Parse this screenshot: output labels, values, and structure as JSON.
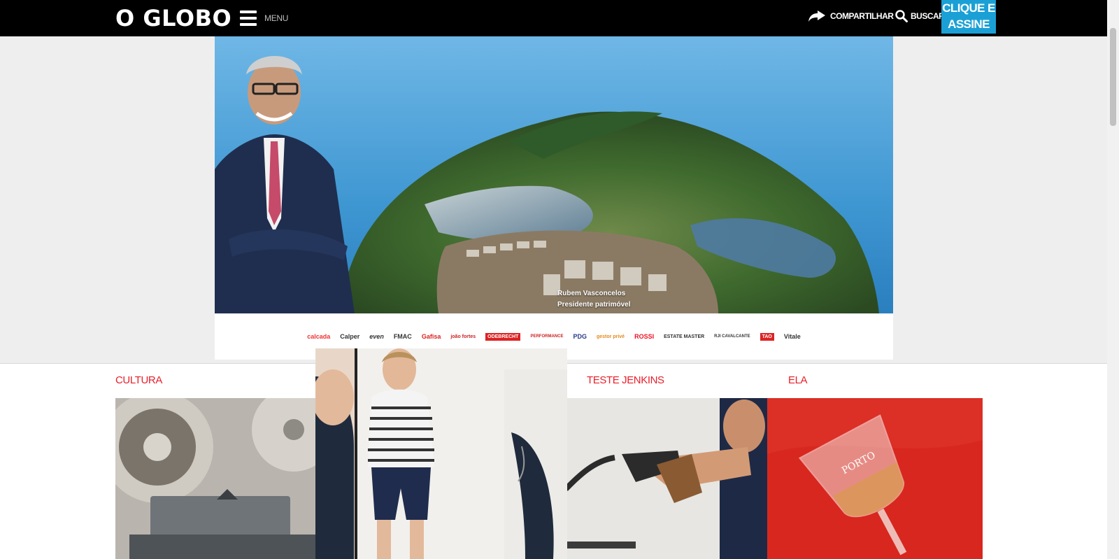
{
  "header": {
    "logo": "O GLOBO",
    "menu_label": "MENU",
    "share_label": "COMPARTILHAR",
    "search_label": "BUSCAR",
    "subscribe_line1": "CLIQUE E",
    "subscribe_line2": "ASSINE",
    "subscribe_color": "#1ba0d6"
  },
  "ad": {
    "caption_name": "Rubem Vasconcelos",
    "caption_role": "Presidente patrimóvel",
    "brands": [
      "calcada",
      "Calper",
      "even",
      "FMAC",
      "Gafisa",
      "joão fortes",
      "ODEBRECHT",
      "PERFORMANCE",
      "PDG",
      "gestor privé",
      "ROSSI",
      "ESTATE MASTER",
      "RJI CAVALCANTE",
      "TAO",
      "Vitale"
    ]
  },
  "sections": [
    {
      "title": "CULTURA"
    },
    {
      "title": "TESTE JENKINS"
    },
    {
      "title": "ELA"
    }
  ],
  "colors": {
    "section_title": "#e8202a",
    "topbar": "#000000",
    "ad_bg": "#eeeeee"
  }
}
